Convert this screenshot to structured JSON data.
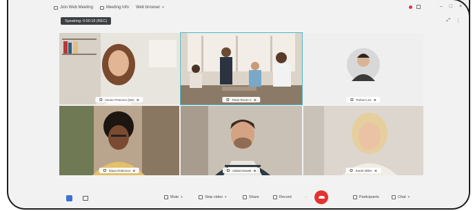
{
  "titlebar": {
    "items": [
      "Join Web Meeting",
      "Meeting Info",
      "Web browser"
    ],
    "controls": [
      "–",
      "□",
      "×"
    ]
  },
  "meeting": {
    "badge": "Speaking: 0:00:18 (REC)"
  },
  "view_controls": [
    "⤢",
    "⋮"
  ],
  "tiles": [
    {
      "name": "Nicole Petersen (Me)"
    },
    {
      "name": "Team Room A"
    },
    {
      "name": "Robert Lee"
    },
    {
      "name": "Maya Robinson"
    },
    {
      "name": "Adrian Novak"
    },
    {
      "name": "Sarah Miller"
    }
  ],
  "toolbar": {
    "mute": "Mute",
    "stop_video": "Stop video",
    "share": "Share",
    "record": "Record",
    "participants": "Participants",
    "chat": "Chat"
  },
  "colors": {
    "active_border": "#48b7c9",
    "end_call": "#e5322f",
    "background": "#f2f2f2"
  }
}
